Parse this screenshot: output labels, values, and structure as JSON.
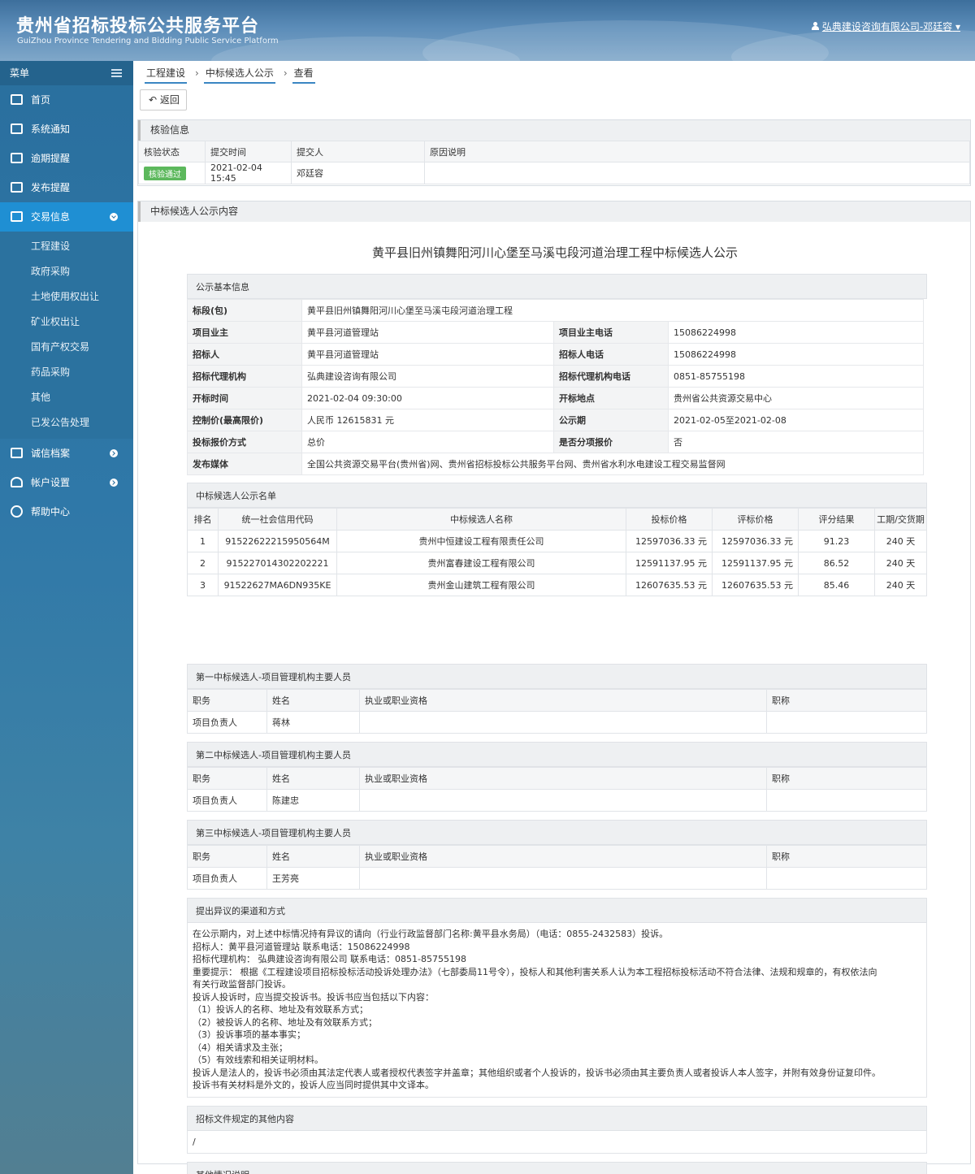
{
  "header": {
    "title_cn": "贵州省招标投标公共服务平台",
    "title_en": "GuiZhou Province Tendering and Bidding Public Service Platform",
    "user": "弘典建设咨询有限公司-邓廷容"
  },
  "sidebar": {
    "menu_label": "菜单",
    "items": [
      {
        "label": "首页",
        "icon": "home-icon"
      },
      {
        "label": "系统通知",
        "icon": "monitor-icon"
      },
      {
        "label": "逾期提醒",
        "icon": "calendar-icon"
      },
      {
        "label": "发布提醒",
        "icon": "calendar-icon"
      },
      {
        "label": "交易信息",
        "icon": "calendar-icon"
      }
    ],
    "subitems": [
      "工程建设",
      "政府采购",
      "土地使用权出让",
      "矿业权出让",
      "国有产权交易",
      "药品采购",
      "其他",
      "已发公告处理"
    ],
    "bottom_items": [
      {
        "label": "诚信档案",
        "icon": "list-icon"
      },
      {
        "label": "帐户设置",
        "icon": "user-icon"
      },
      {
        "label": "帮助中心",
        "icon": "help-icon"
      }
    ]
  },
  "breadcrumb": [
    "工程建设",
    "中标候选人公示",
    "查看"
  ],
  "back_label": "返回",
  "verify": {
    "title": "核验信息",
    "headers": [
      "核验状态",
      "提交时间",
      "提交人",
      "原因说明"
    ],
    "status": "核验通过",
    "time": "2021-02-04 15:45",
    "submitter": "邓廷容",
    "reason": ""
  },
  "content": {
    "panel_title": "中标候选人公示内容",
    "title": "黄平县旧州镇舞阳河川心堡至马溪屯段河道治理工程中标候选人公示",
    "basic_title": "公示基本信息",
    "basic": {
      "section_label": "标段(包)",
      "section_value": "黄平县旧州镇舞阳河川心堡至马溪屯段河道治理工程",
      "rows": [
        [
          "项目业主",
          "黄平县河道管理站",
          "项目业主电话",
          "15086224998"
        ],
        [
          "招标人",
          "黄平县河道管理站",
          "招标人电话",
          "15086224998"
        ],
        [
          "招标代理机构",
          "弘典建设咨询有限公司",
          "招标代理机构电话",
          "0851-85755198"
        ],
        [
          "开标时间",
          "2021-02-04 09:30:00",
          "开标地点",
          "贵州省公共资源交易中心"
        ],
        [
          "控制价(最高限价)",
          "人民币 12615831 元",
          "公示期",
          "2021-02-05至2021-02-08"
        ],
        [
          "投标报价方式",
          "总价",
          "是否分项报价",
          "否"
        ]
      ],
      "media_label": "发布媒体",
      "media_value": "全国公共资源交易平台(贵州省)网、贵州省招标投标公共服务平台网、贵州省水利水电建设工程交易监督网"
    },
    "cand_title": "中标候选人公示名单",
    "cand_headers": [
      "排名",
      "统一社会信用代码",
      "中标候选人名称",
      "投标价格",
      "评标价格",
      "评分结果",
      "工期/交货期"
    ],
    "candidates": [
      [
        "1",
        "91522622215950564M",
        "贵州中恒建设工程有限责任公司",
        "12597036.33 元",
        "12597036.33 元",
        "91.23",
        "240 天"
      ],
      [
        "2",
        "915227014302202221",
        "贵州富春建设工程有限公司",
        "12591137.95 元",
        "12591137.95 元",
        "86.52",
        "240 天"
      ],
      [
        "3",
        "91522627MA6DN935KE",
        "贵州金山建筑工程有限公司",
        "12607635.53 元",
        "12607635.53 元",
        "85.46",
        "240 天"
      ]
    ],
    "staff_headers": [
      "职务",
      "姓名",
      "执业或职业资格",
      "职称"
    ],
    "staff": [
      {
        "title": "第一中标候选人-项目管理机构主要人员",
        "role": "项目负责人",
        "name": "蒋林"
      },
      {
        "title": "第二中标候选人-项目管理机构主要人员",
        "role": "项目负责人",
        "name": "陈建忠"
      },
      {
        "title": "第三中标候选人-项目管理机构主要人员",
        "role": "项目负责人",
        "name": "王芳亮"
      }
    ],
    "objection_title": "提出异议的渠道和方式",
    "objection_lines": [
      "在公示期内，对上述中标情况持有异议的请向（行业行政监督部门名称:黄平县水务局）（电话：0855-2432583）投诉。",
      "招标人：黄平县河道管理站 联系电话：15086224998",
      "招标代理机构： 弘典建设咨询有限公司 联系电话：0851-85755198",
      "重要提示： 根据《工程建设项目招标投标活动投诉处理办法》（七部委局11号令），投标人和其他利害关系人认为本工程招标投标活动不符合法律、法规和规章的，有权依法向",
      "有关行政监督部门投诉。",
      "投诉人投诉时，应当提交投诉书。投诉书应当包括以下内容：",
      "（1）投诉人的名称、地址及有效联系方式；",
      "（2）被投诉人的名称、地址及有效联系方式；",
      "（3）投诉事项的基本事实；",
      "（4）相关请求及主张；",
      "（5）有效线索和相关证明材料。",
      "投诉人是法人的，投诉书必须由其法定代表人或者授权代表签字并盖章；其他组织或者个人投诉的，投诉书必须由其主要负责人或者投诉人本人签字，并附有效身份证复印件。",
      "投诉书有关材料是外文的，投诉人应当同时提供其中文译本。"
    ],
    "other_doc_title": "招标文件规定的其他内容",
    "other_doc_value": "/",
    "other_title": "其他情况说明",
    "other_value": "/"
  }
}
